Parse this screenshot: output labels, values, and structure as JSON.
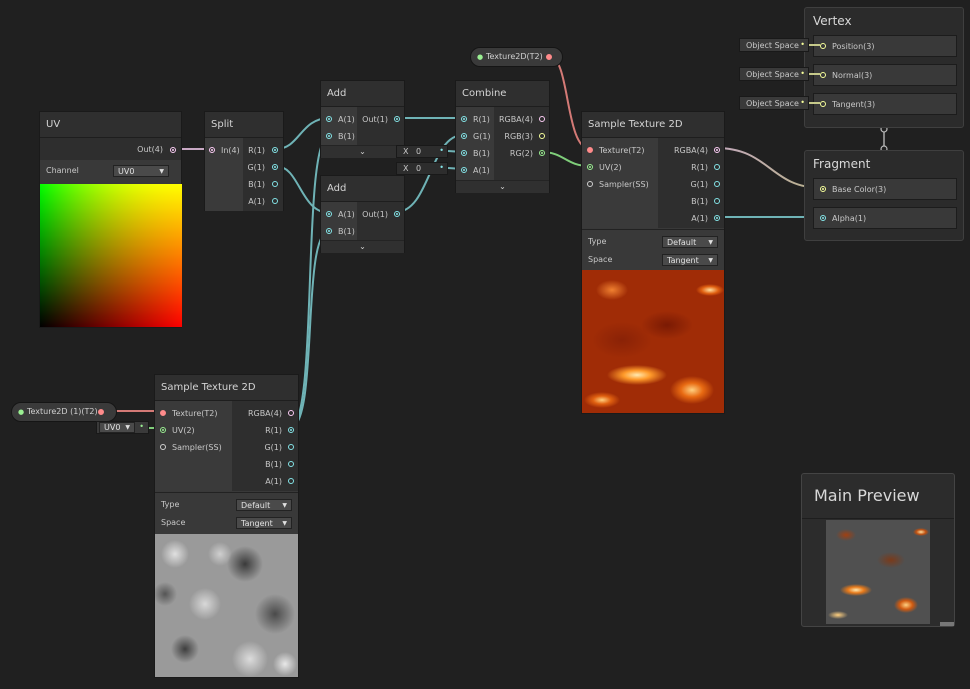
{
  "colors": {
    "vec": "#84e4e7",
    "vec2": "#9aef92",
    "vec4": "#fbcbf4",
    "tex": "#ff8b8b",
    "float": "#84e4e7",
    "gray": "#aeaeae"
  },
  "uv_node": {
    "title": "UV",
    "out": "Out(4)",
    "channel_label": "Channel",
    "channel_value": "UV0"
  },
  "split_node": {
    "title": "Split",
    "in": "In(4)",
    "outs": [
      "R(1)",
      "G(1)",
      "B(1)",
      "A(1)"
    ]
  },
  "add1": {
    "title": "Add",
    "ins": [
      "A(1)",
      "B(1)"
    ],
    "out": "Out(1)"
  },
  "add2": {
    "title": "Add",
    "ins": [
      "A(1)",
      "B(1)"
    ],
    "out": "Out(1)"
  },
  "combine": {
    "title": "Combine",
    "ins": [
      "R(1)",
      "G(1)",
      "B(1)",
      "A(1)"
    ],
    "outs": [
      "RGBA(4)",
      "RGB(3)",
      "RG(2)"
    ],
    "b_field": {
      "label": "X",
      "value": "0"
    },
    "a_field": {
      "label": "X",
      "value": "0"
    }
  },
  "tex_prop_top": {
    "label": "Texture2D(T2)"
  },
  "tex_prop_left": {
    "label": "Texture2D (1)(T2)"
  },
  "uv_inline": {
    "value": "UV0"
  },
  "sample_top": {
    "title": "Sample Texture 2D",
    "ins": [
      "Texture(T2)",
      "UV(2)",
      "Sampler(SS)"
    ],
    "outs": [
      "RGBA(4)",
      "R(1)",
      "G(1)",
      "B(1)",
      "A(1)"
    ],
    "type_label": "Type",
    "type_value": "Default",
    "space_label": "Space",
    "space_value": "Tangent"
  },
  "sample_bottom": {
    "title": "Sample Texture 2D",
    "ins": [
      "Texture(T2)",
      "UV(2)",
      "Sampler(SS)"
    ],
    "outs": [
      "RGBA(4)",
      "R(1)",
      "G(1)",
      "B(1)",
      "A(1)"
    ],
    "type_label": "Type",
    "type_value": "Default",
    "space_label": "Space",
    "space_value": "Tangent"
  },
  "vertex": {
    "title": "Vertex",
    "slots": [
      "Position(3)",
      "Normal(3)",
      "Tangent(3)"
    ],
    "spaces": [
      "Object Space",
      "Object Space",
      "Object Space"
    ]
  },
  "fragment": {
    "title": "Fragment",
    "slots": [
      "Base Color(3)",
      "Alpha(1)"
    ]
  },
  "main_preview": {
    "title": "Main Preview"
  }
}
